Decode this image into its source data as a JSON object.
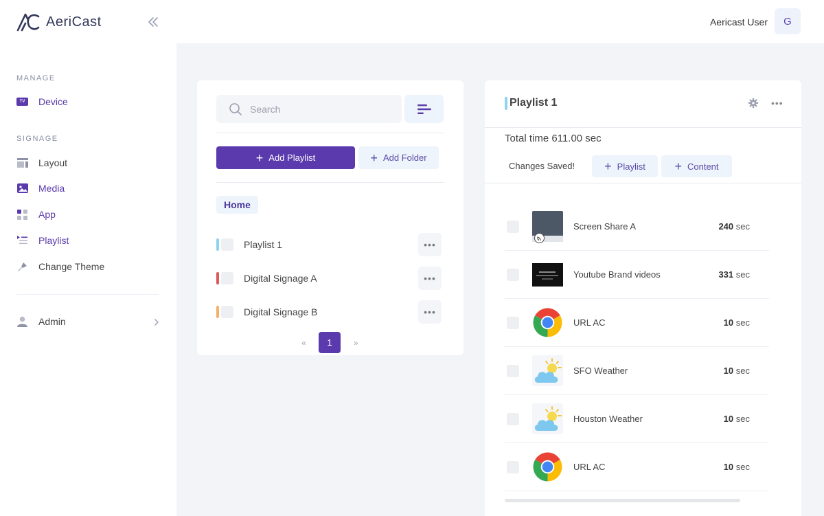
{
  "app": {
    "name": "AeriCast"
  },
  "sidebar": {
    "manage_label": "MANAGE",
    "signage_label": "SIGNAGE",
    "device_badge": "TV",
    "items": [
      {
        "label": "Device"
      },
      {
        "label": "Layout"
      },
      {
        "label": "Media"
      },
      {
        "label": "App"
      },
      {
        "label": "Playlist"
      },
      {
        "label": "Change Theme"
      },
      {
        "label": "Admin"
      }
    ]
  },
  "header": {
    "user_name": "Aericast User",
    "avatar_initial": "G"
  },
  "playlists_panel": {
    "search_placeholder": "Search",
    "add_playlist_label": "Add Playlist",
    "add_folder_label": "Add Folder",
    "breadcrumb": "Home",
    "items": [
      {
        "label": "Playlist 1",
        "color": "#8fd3ef"
      },
      {
        "label": "Digital Signage A",
        "color": "#dc5a5a"
      },
      {
        "label": "Digital Signage B",
        "color": "#f5b06b"
      }
    ],
    "more_glyph": "•••",
    "pagination": {
      "prev": "«",
      "current": "1",
      "next": "»"
    }
  },
  "detail_panel": {
    "title": "Playlist 1",
    "more_glyph": "•••",
    "total_time": "Total time 611.00 sec",
    "status": "Changes Saved!",
    "add_playlist_label": "Playlist",
    "add_content_label": "Content",
    "items": [
      {
        "name": "Screen Share A",
        "duration": "240",
        "unit": "sec",
        "thumb": "screen-share"
      },
      {
        "name": "Youtube Brand videos",
        "duration": "331",
        "unit": "sec",
        "thumb": "video"
      },
      {
        "name": "URL AC",
        "duration": "10",
        "unit": "sec",
        "thumb": "chrome"
      },
      {
        "name": "SFO Weather",
        "duration": "10",
        "unit": "sec",
        "thumb": "weather"
      },
      {
        "name": "Houston Weather",
        "duration": "10",
        "unit": "sec",
        "thumb": "weather"
      },
      {
        "name": "URL AC",
        "duration": "10",
        "unit": "sec",
        "thumb": "chrome"
      }
    ]
  },
  "colors": {
    "accent": "#5a3aac",
    "chip_bg": "#eef4fb",
    "nav_active": "#5a3aac"
  }
}
